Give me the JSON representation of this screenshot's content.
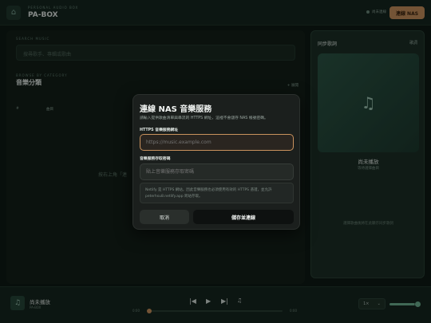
{
  "header": {
    "brand_small": "PERSONAL AUDIO BOX",
    "brand_title": "PA-BOX",
    "status_text": "尚未連線",
    "nas_button": "連線 NAS"
  },
  "library": {
    "search_label": "SEARCH MUSIC",
    "search_placeholder": "搜尋歌手、專輯或歌曲",
    "browse_label": "BROWSE BY CATEGORY",
    "category_title": "音樂分類",
    "expand_label": "+ 展開",
    "col_index": "#",
    "col_title": "曲目",
    "empty_hint": "按右上角「連"
  },
  "lyrics": {
    "title": "同步歌詞",
    "badge": "歌詞",
    "art_icon": "music-note",
    "now_title": "尚未播放",
    "now_sub": "等待選擇曲目",
    "empty_text": "選擇歌曲後將在此顯示同步歌詞"
  },
  "player": {
    "track_title": "尚未播放",
    "track_sub": "PA-BOX",
    "time_current": "0:00",
    "time_total": "0:00",
    "progress": 0,
    "speed": "1×",
    "volume": 0.85
  },
  "modal": {
    "title": "連線 NAS 音樂服務",
    "subtitle": "請輸入提供歌曲清單與串流的 HTTPS 網址，這裡不會儲存 NAS 帳號密碼。",
    "url_label": "HTTPS 音樂服務網址",
    "url_placeholder": "https://music.example.com",
    "code_label": "音樂服務存取密碼",
    "code_placeholder": "貼上音樂服務存取密碼",
    "note": "Netlify 是 HTTPS 網站，因此音樂服務也必須使用有效的 HTTPS 憑證，並允許 peterhsu8.netlify.app 跨站存取。",
    "cancel": "取消",
    "save": "儲存並連線"
  },
  "colors": {
    "accent": "#c9925d",
    "panel": "#142019",
    "modal_bg": "#1b1f1d"
  }
}
